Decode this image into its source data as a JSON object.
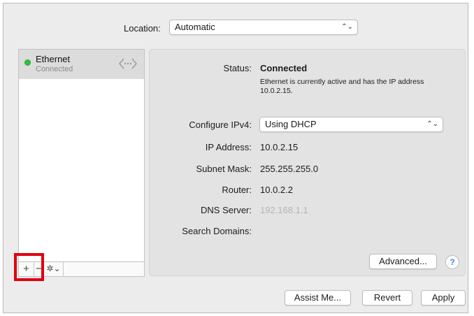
{
  "location": {
    "label": "Location:",
    "value": "Automatic"
  },
  "sidebar": {
    "services": [
      {
        "name": "Ethernet",
        "status": "Connected",
        "status_color": "#2fc23a",
        "icon": "ethernet-icon"
      }
    ],
    "toolbar": {
      "add": "+",
      "remove": "−",
      "gear": "✲⌄"
    }
  },
  "details": {
    "status_label": "Status:",
    "status_value": "Connected",
    "status_description": "Ethernet is currently active and has the IP address 10.0.2.15.",
    "configure_label": "Configure IPv4:",
    "configure_value": "Using DHCP",
    "ip_label": "IP Address:",
    "ip_value": "10.0.2.15",
    "subnet_label": "Subnet Mask:",
    "subnet_value": "255.255.255.0",
    "router_label": "Router:",
    "router_value": "10.0.2.2",
    "dns_label": "DNS Server:",
    "dns_value": "192.168.1.1",
    "search_label": "Search Domains:",
    "search_value": "",
    "advanced_label": "Advanced...",
    "help_label": "?"
  },
  "footer": {
    "assist_label": "Assist Me...",
    "revert_label": "Revert",
    "apply_label": "Apply"
  },
  "colors": {
    "highlight": "#e2000f",
    "connected": "#2fc23a"
  }
}
